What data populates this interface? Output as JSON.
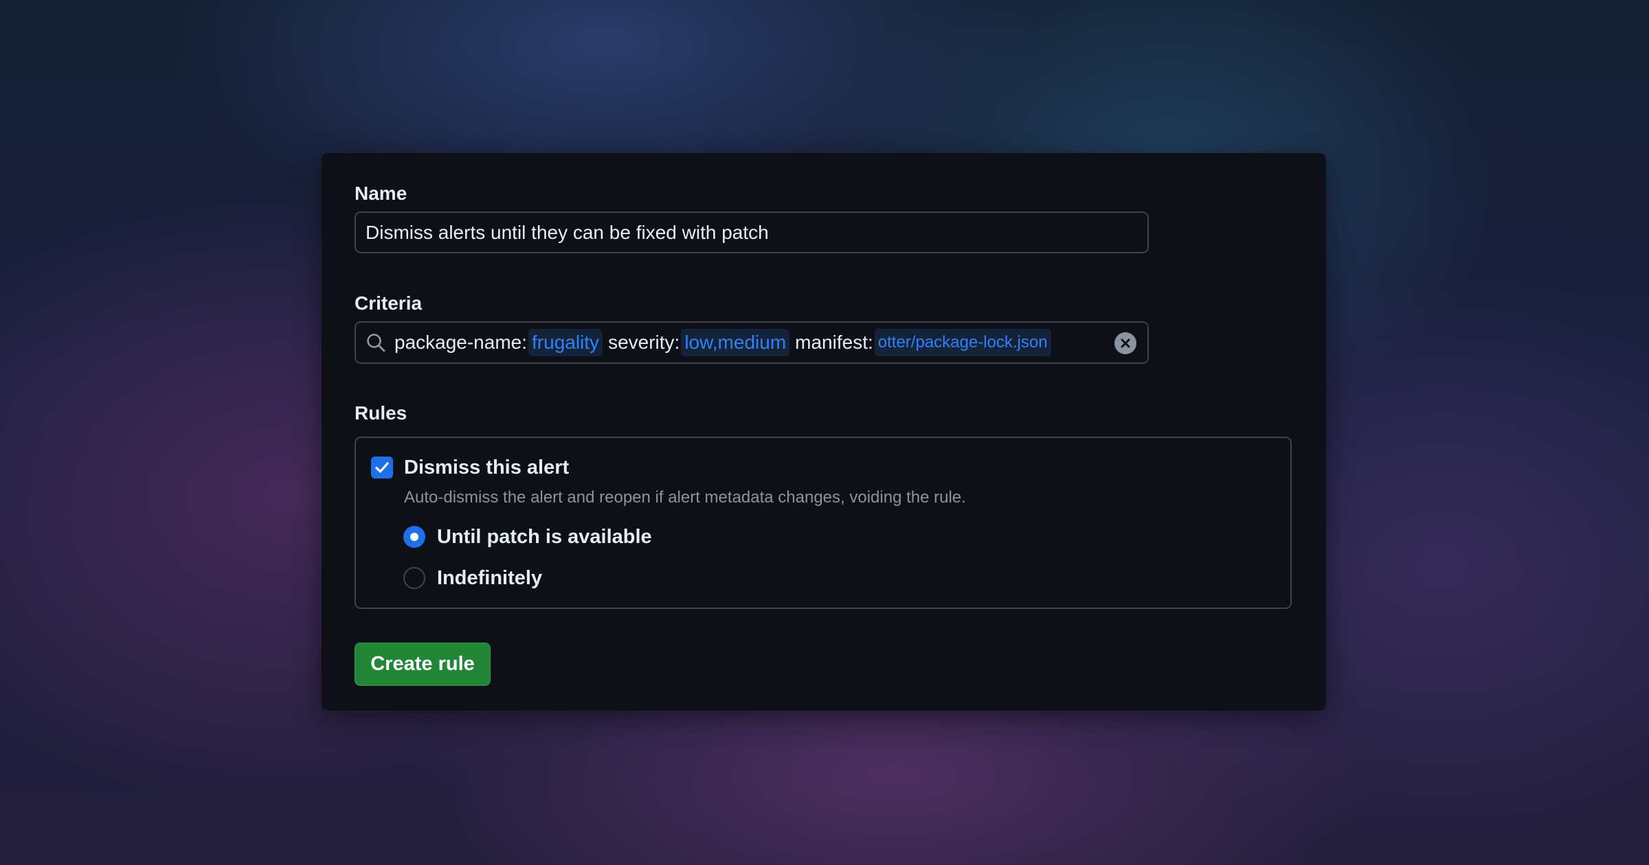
{
  "form": {
    "name_label": "Name",
    "name_value": "Dismiss alerts until they can be fixed with patch",
    "criteria_label": "Criteria",
    "criteria": [
      {
        "qualifier": "package-name:",
        "value": "frugality"
      },
      {
        "qualifier": "severity:",
        "value": "low,medium"
      },
      {
        "qualifier": "manifest:",
        "value": "otter/package-lock.json"
      }
    ],
    "rules_label": "Rules",
    "rules": {
      "dismiss_label": "Dismiss this alert",
      "dismiss_checked": true,
      "dismiss_description": "Auto-dismiss the alert and reopen if alert metadata changes, voiding the rule.",
      "options": [
        {
          "label": "Until patch is available",
          "selected": true
        },
        {
          "label": "Indefinitely",
          "selected": false
        }
      ]
    },
    "submit_label": "Create rule"
  },
  "colors": {
    "accent": "#1f6feb",
    "token_text": "#2f81f7",
    "submit_green": "#238636",
    "card_bg": "#0d1117"
  },
  "icons": {
    "search": "search-icon",
    "clear": "x-circle-icon",
    "check": "check-icon"
  }
}
